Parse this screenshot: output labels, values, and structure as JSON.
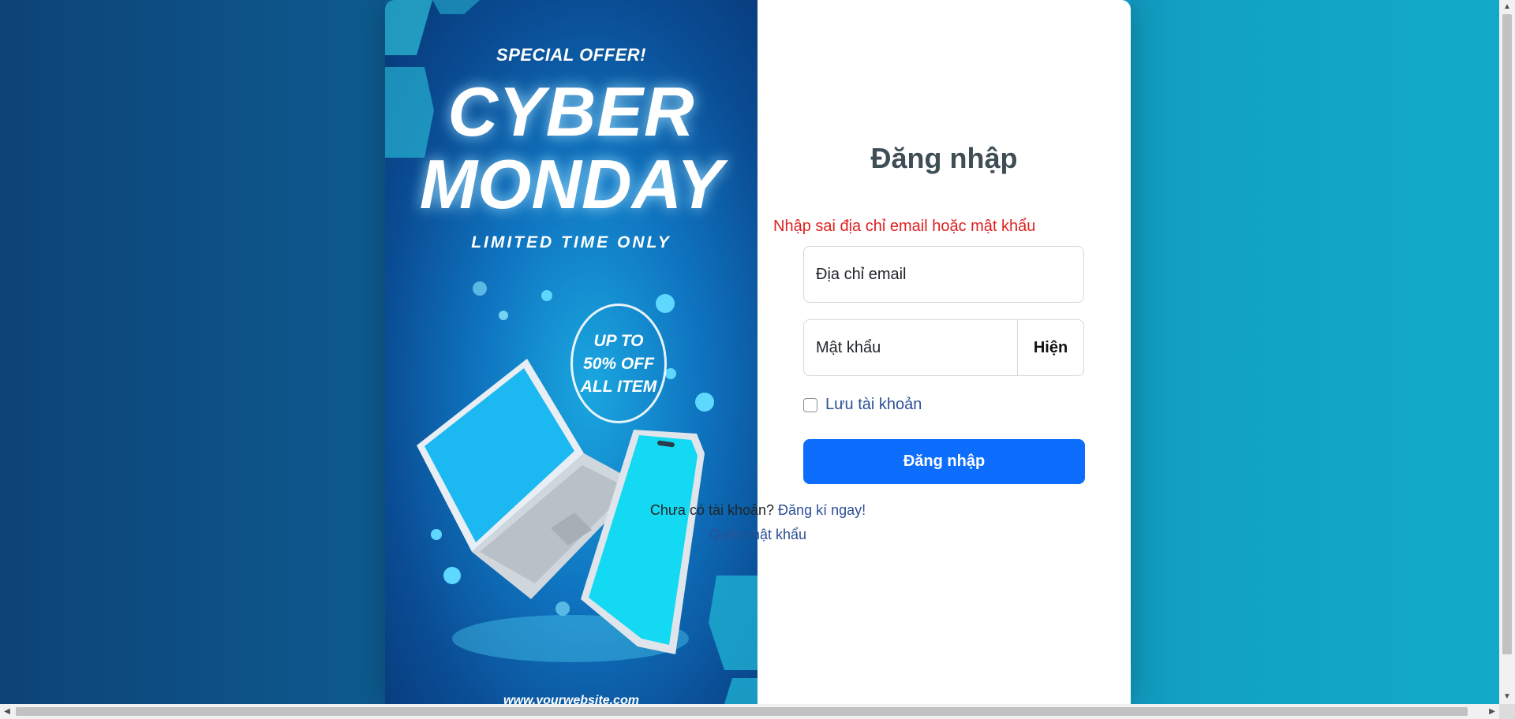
{
  "banner": {
    "special": "SPECIAL OFFER!",
    "cyber": "CYBER",
    "monday": "MONDAY",
    "limited": "LIMITED TIME ONLY",
    "badge_line1": "UP TO",
    "badge_line2": "50% OFF",
    "badge_line3": "ALL ITEM",
    "website": "www.yourwebsite.com"
  },
  "login": {
    "title": "Đăng nhập",
    "error": "Nhập sai địa chỉ email hoặc mật khẩu",
    "email_placeholder": "Địa chỉ email",
    "password_placeholder": "Mật khẩu",
    "show_label": "Hiện",
    "remember_label": "Lưu tài khoản",
    "submit_label": "Đăng nhập",
    "no_account_text": "Chưa có tài khoản?",
    "signup_link": "Đăng kí ngay!",
    "forgot_link": "Quên mật khẩu"
  },
  "colors": {
    "primary": "#0d6efd",
    "error": "#e02020",
    "link": "#2c4f97",
    "title": "#3f4d55"
  },
  "icons": {
    "scroll_up": "▲",
    "scroll_down": "▼",
    "scroll_left": "◀",
    "scroll_right": "▶"
  }
}
